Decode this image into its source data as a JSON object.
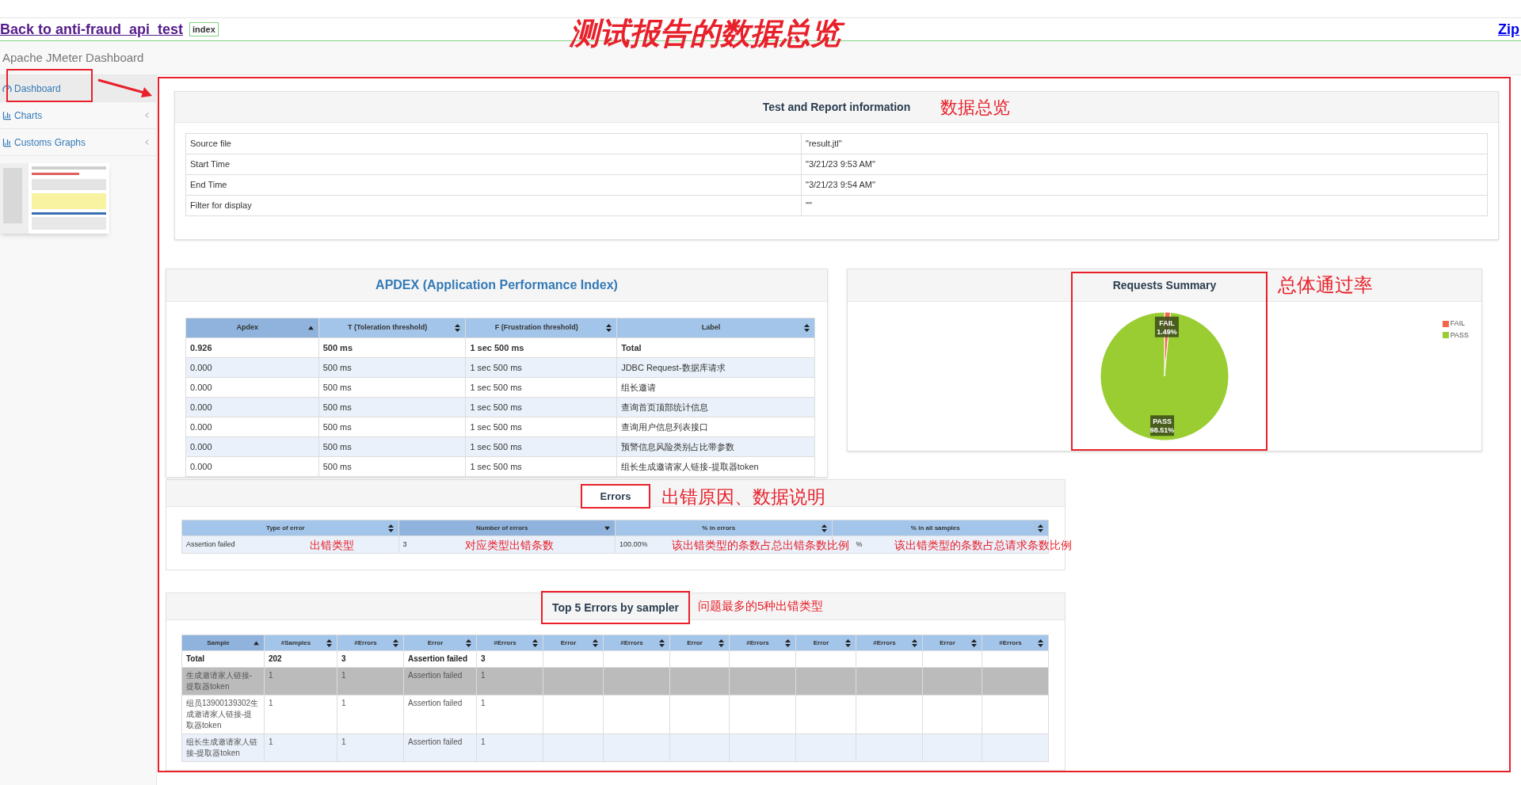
{
  "header": {
    "back_link": "Back to anti-fraud_api_test",
    "badge": "index",
    "zip_link": "Zip"
  },
  "annotation_title": "测试报告的数据总览",
  "navbar": {
    "title": "Apache JMeter Dashboard"
  },
  "sidebar": {
    "items": [
      {
        "label": "Dashboard",
        "selected": true,
        "highlighted": true,
        "collapsible": false
      },
      {
        "label": "Charts",
        "selected": false,
        "highlighted": false,
        "collapsible": true
      },
      {
        "label": "Customs Graphs",
        "selected": false,
        "highlighted": false,
        "collapsible": true
      }
    ]
  },
  "main_framed": true,
  "test_info": {
    "title": "Test and Report information",
    "annotation": "数据总览",
    "rows": [
      {
        "label": "Source file",
        "value": "\"result.jtl\""
      },
      {
        "label": "Start Time",
        "value": "\"3/21/23 9:53 AM\""
      },
      {
        "label": "End Time",
        "value": "\"3/21/23 9:54 AM\""
      },
      {
        "label": "Filter for display",
        "value": "\"\""
      }
    ]
  },
  "apdex": {
    "title": "APDEX (Application Performance Index)",
    "columns": [
      {
        "label": "Apdex",
        "sorted": true,
        "descending": false
      },
      {
        "label": "T (Toleration threshold)",
        "sorted": false
      },
      {
        "label": "F (Frustration threshold)",
        "sorted": false
      },
      {
        "label": "Label",
        "sorted": false
      }
    ],
    "rows": [
      {
        "kind": "total",
        "cells": [
          "0.926",
          "500 ms",
          "1 sec 500 ms",
          "Total"
        ]
      },
      {
        "kind": "sample",
        "cells": [
          "0.000",
          "500 ms",
          "1 sec 500 ms",
          "JDBC Request-数据库请求"
        ]
      },
      {
        "kind": "sample",
        "cells": [
          "0.000",
          "500 ms",
          "1 sec 500 ms",
          "组长邀请"
        ]
      },
      {
        "kind": "sample",
        "cells": [
          "0.000",
          "500 ms",
          "1 sec 500 ms",
          "查询首页顶部统计信息"
        ]
      },
      {
        "kind": "sample",
        "cells": [
          "0.000",
          "500 ms",
          "1 sec 500 ms",
          "查询用户信息列表接口"
        ]
      },
      {
        "kind": "sample",
        "cells": [
          "0.000",
          "500 ms",
          "1 sec 500 ms",
          "预警信息风险类别占比带参数"
        ]
      },
      {
        "kind": "sample",
        "cells": [
          "0.000",
          "500 ms",
          "1 sec 500 ms",
          "组长生成邀请家人链接-提取器token"
        ]
      }
    ]
  },
  "requests_summary": {
    "title": "Requests Summary",
    "annotation": "总体通过率",
    "highlighted": true,
    "legend": [
      {
        "label": "FAIL",
        "color": "#f4664a"
      },
      {
        "label": "PASS",
        "color": "#9acd32"
      }
    ],
    "chart_data": {
      "type": "pie",
      "categories": [
        "FAIL",
        "PASS"
      ],
      "values": [
        1.49,
        98.51
      ],
      "value_labels": [
        "1.49%",
        "98.51%"
      ]
    }
  },
  "errors": {
    "title": "Errors",
    "highlighted": true,
    "annotation": "出错原因、数据说明",
    "columns": [
      {
        "label": "Type of error",
        "sorted": false
      },
      {
        "label": "Number of errors",
        "sorted": true,
        "descending": true
      },
      {
        "label": "% in errors",
        "sorted": false
      },
      {
        "label": "% in all samples",
        "sorted": false
      }
    ],
    "rows": [
      {
        "cells": [
          {
            "text": "Assertion failed",
            "annotation": "出错类型"
          },
          {
            "text": "3",
            "annotation": "对应类型出错条数"
          },
          {
            "text": "100.00%",
            "annotation": "该出错类型的条数占总出错条数比例"
          },
          {
            "text": "%",
            "annotation": "该出错类型的条数占总请求条数比例"
          }
        ]
      }
    ]
  },
  "top5": {
    "title": "Top 5 Errors by sampler",
    "highlighted": true,
    "annotation": "问题最多的5种出错类型",
    "columns": [
      {
        "label": "Sample",
        "sorted": true,
        "descending": false
      },
      {
        "label": "#Samples",
        "sorted": false
      },
      {
        "label": "#Errors",
        "sorted": false
      },
      {
        "label": "Error",
        "sorted": false
      },
      {
        "label": "#Errors",
        "sorted": false
      },
      {
        "label": "Error",
        "sorted": false
      },
      {
        "label": "#Errors",
        "sorted": false
      },
      {
        "label": "Error",
        "sorted": false
      },
      {
        "label": "#Errors",
        "sorted": false
      },
      {
        "label": "Error",
        "sorted": false
      },
      {
        "label": "#Errors",
        "sorted": false
      },
      {
        "label": "Error",
        "sorted": false
      },
      {
        "label": "#Errors",
        "sorted": false
      }
    ],
    "rows": [
      {
        "kind": "total",
        "highlighted": false,
        "cells": [
          "Total",
          "202",
          "3",
          "Assertion failed",
          "3"
        ]
      },
      {
        "kind": "sample",
        "highlighted": true,
        "cells": [
          "生成邀请家人链接-提取器token",
          "1",
          "1",
          "Assertion failed",
          "1"
        ]
      },
      {
        "kind": "sample",
        "highlighted": false,
        "cells": [
          "组员13900139302生成邀请家人链接-提取器token",
          "1",
          "1",
          "Assertion failed",
          "1"
        ]
      },
      {
        "kind": "sample",
        "highlighted": false,
        "cells": [
          "组长生成邀请家人链接-提取器token",
          "1",
          "1",
          "Assertion failed",
          "1"
        ]
      }
    ]
  }
}
